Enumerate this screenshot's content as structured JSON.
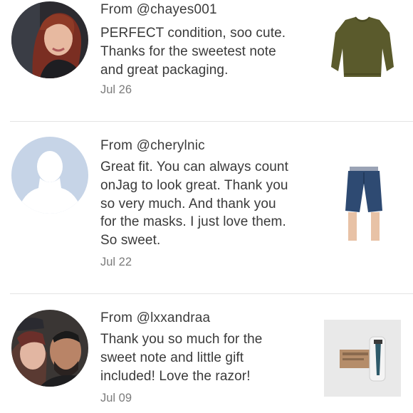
{
  "reviews": [
    {
      "from_prefix": "From ",
      "username": "@chayes001",
      "text": "PERFECT condition, soo cute.\nThanks for the sweetest note\nand great packaging.",
      "date": "Jul 26",
      "avatar": "profile-photo-woman-red-hair",
      "item": "olive-green-sweater"
    },
    {
      "from_prefix": "From ",
      "username": "@cherylnic",
      "text": "Great fit. You can always count\nonJag to look great. Thank you\nso very much.  And thank you\nfor the masks. I just love them.\nSo sweet.",
      "date": "Jul 22",
      "avatar": "default-profile-silhouette",
      "item": "denim-bermuda-shorts"
    },
    {
      "from_prefix": "From ",
      "username": "@lxxandraa",
      "text": "Thank you so much for the\nsweet note and little gift\nincluded! Love the razor!",
      "date": "Jul 09",
      "avatar": "profile-photo-couple",
      "item": "razor-in-package"
    }
  ],
  "colors": {
    "text": "#3a3a3a",
    "date": "#7b7b7b",
    "divider": "#e4e4e4",
    "default_avatar_bg": "#c6d4e7"
  }
}
